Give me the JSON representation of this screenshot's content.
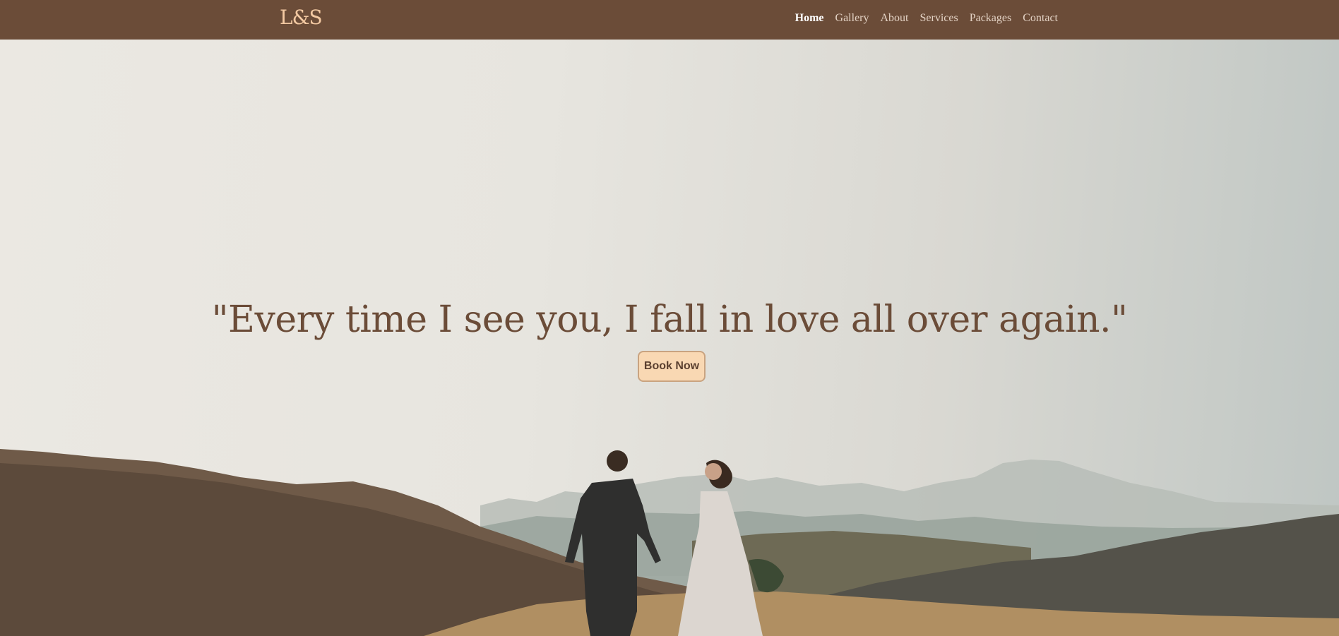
{
  "brand": {
    "logo_text": "L&S"
  },
  "nav": {
    "items": [
      {
        "label": "Home",
        "active": true
      },
      {
        "label": "Gallery",
        "active": false
      },
      {
        "label": "About",
        "active": false
      },
      {
        "label": "Services",
        "active": false
      },
      {
        "label": "Packages",
        "active": false
      },
      {
        "label": "Contact",
        "active": false
      }
    ]
  },
  "hero": {
    "quote": "\"Every time I see you, I fall in love all over again.\"",
    "cta_label": "Book Now",
    "image_subject": "couple-walking-hills-photo"
  },
  "colors": {
    "nav_bg": "#6b4c38",
    "logo": "#f3c9a2",
    "quote_text": "#6b4c38",
    "button_bg": "#f9d8b3",
    "button_border": "#c9a380"
  }
}
